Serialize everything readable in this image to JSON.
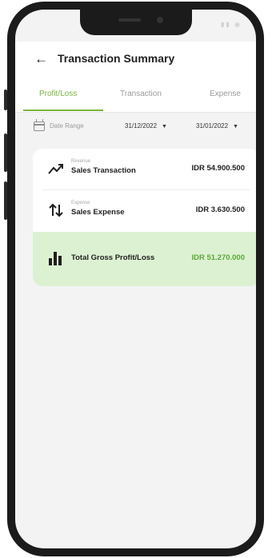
{
  "header": {
    "title": "Transaction Summary"
  },
  "tabs": [
    {
      "label": "Profit/Loss",
      "active": true
    },
    {
      "label": "Transaction",
      "active": false
    },
    {
      "label": "Expense",
      "active": false
    }
  ],
  "filters": {
    "date_range_label": "Date Range",
    "start_date": "31/12/2022",
    "end_date": "31/01/2022"
  },
  "summary": {
    "revenue": {
      "caption": "Revenue",
      "label": "Sales Transaction",
      "amount": "IDR 54.900.500"
    },
    "expense": {
      "caption": "Expense",
      "label": "Sales Expense",
      "amount": "IDR 3.630.500"
    },
    "total": {
      "label": "Total Gross Profit/Loss",
      "amount": "IDR 51.270.000"
    }
  },
  "colors": {
    "accent": "#7cb342",
    "total_bg": "#dcf1d1",
    "total_amount": "#5aa73b"
  }
}
